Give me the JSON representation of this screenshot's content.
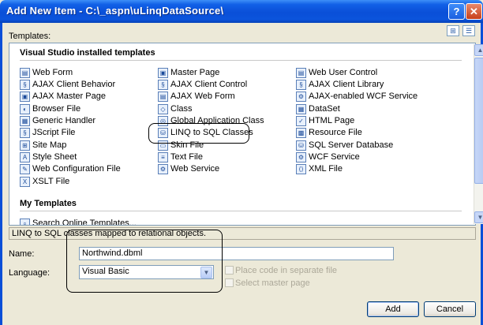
{
  "window": {
    "title": "Add New Item - C:\\_aspn\\uLinqDataSource\\",
    "help_glyph": "?",
    "close_glyph": "✕"
  },
  "templates_label": "Templates:",
  "view_buttons": {
    "large_icons": "⊞",
    "small_icons": "☰"
  },
  "groups": {
    "installed": "Visual Studio installed templates",
    "my_templates": "My Templates"
  },
  "templates": {
    "col1": [
      "Web Form",
      "AJAX Client Behavior",
      "AJAX Master Page",
      "Browser File",
      "Generic Handler",
      "JScript File",
      "Site Map",
      "Style Sheet",
      "Web Configuration File",
      "XSLT File"
    ],
    "col2": [
      "Master Page",
      "AJAX Client Control",
      "AJAX Web Form",
      "Class",
      "Global Application Class",
      "LINQ to SQL Classes",
      "Skin File",
      "Text File",
      "Web Service"
    ],
    "col3": [
      "Web User Control",
      "AJAX Client Library",
      "AJAX-enabled WCF Service",
      "DataSet",
      "HTML Page",
      "Resource File",
      "SQL Server Database",
      "WCF Service",
      "XML File"
    ]
  },
  "my_templates_partial": "Search Online Templates...",
  "description": "LINQ to SQL classes mapped to relational objects.",
  "name_label": "Name:",
  "name_value": "Northwind.dbml",
  "language_label": "Language:",
  "language_value": "Visual Basic",
  "options": {
    "separate_file": "Place code in separate file",
    "master_page": "Select master page"
  },
  "buttons": {
    "add": "Add",
    "cancel": "Cancel"
  },
  "colors": {
    "title_bar": "#0a4fd8",
    "dialog_bg": "#ece9d8"
  }
}
